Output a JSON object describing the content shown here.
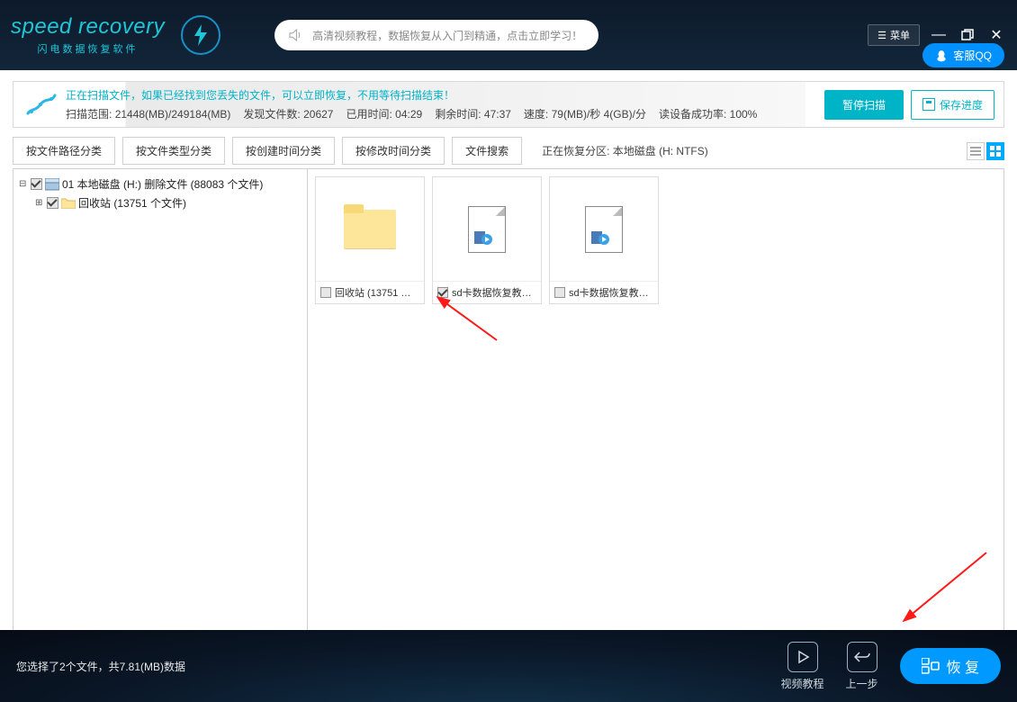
{
  "titlebar": {
    "logo_text": "speed recovery",
    "logo_sub": "闪电数据恢复软件",
    "notice": "高清视频教程，数据恢复从入门到精通，点击立即学习！",
    "menu": "菜单",
    "qq_label": "客服QQ"
  },
  "scan": {
    "message": "正在扫描文件，如果已经找到您丢失的文件，可以立即恢复，不用等待扫描结束！",
    "range_label": "扫描范围:",
    "range_value": "21448(MB)/249184(MB)",
    "found_label": "发现文件数:",
    "found_value": "20627",
    "elapsed_label": "已用时间:",
    "elapsed_value": "04:29",
    "remain_label": "剩余时间:",
    "remain_value": "47:37",
    "speed_label": "速度:",
    "speed_value": "79(MB)/秒  4(GB)/分",
    "success_label": "读设备成功率:",
    "success_value": "100%",
    "pause": "暂停扫描",
    "save": "保存进度"
  },
  "tabs": {
    "items": [
      "按文件路径分类",
      "按文件类型分类",
      "按创建时间分类",
      "按修改时间分类",
      "文件搜索"
    ],
    "partition_label": "正在恢复分区: 本地磁盘 (H: NTFS)"
  },
  "tree": {
    "root": "01 本地磁盘 (H:) 删除文件  (88083 个文件)",
    "child": "回收站    (13751 个文件)"
  },
  "files": {
    "items": [
      {
        "label": "回收站 (13751 …",
        "type": "folder",
        "checked": false
      },
      {
        "label": "sd卡数据恢复教…",
        "type": "video",
        "checked": true
      },
      {
        "label": "sd卡数据恢复教…",
        "type": "video",
        "checked": false
      }
    ]
  },
  "footer": {
    "text": "您选择了2个文件，共7.81(MB)数据",
    "video": "视频教程",
    "back": "上一步",
    "recover": "恢 复"
  }
}
